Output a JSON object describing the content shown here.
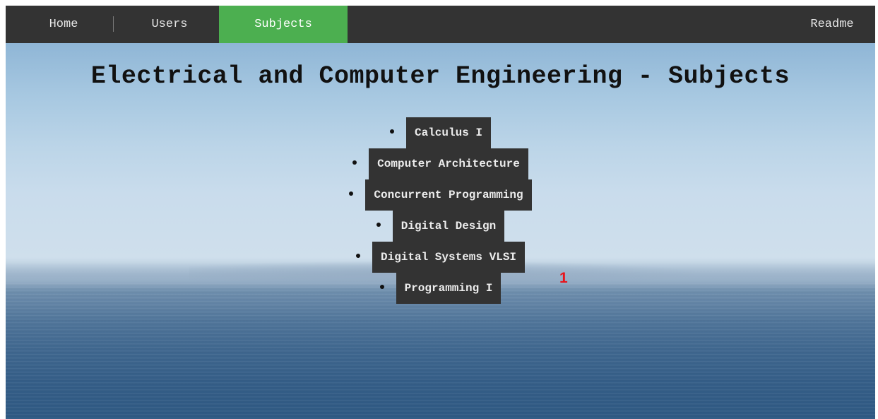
{
  "nav": {
    "items": [
      {
        "label": "Home",
        "active": false
      },
      {
        "label": "Users",
        "active": false
      },
      {
        "label": "Subjects",
        "active": true
      }
    ],
    "readme_label": "Readme"
  },
  "page": {
    "title": "Electrical and Computer Engineering - Subjects"
  },
  "subjects": [
    "Calculus I",
    "Computer Architecture",
    "Concurrent Programming",
    "Digital Design",
    "Digital Systems VLSI",
    "Programming I"
  ],
  "annotation": {
    "marker": "1"
  },
  "colors": {
    "navbar": "#333333",
    "active_tab": "#4caf50",
    "button_bg": "#333333",
    "marker": "#e8141b"
  }
}
